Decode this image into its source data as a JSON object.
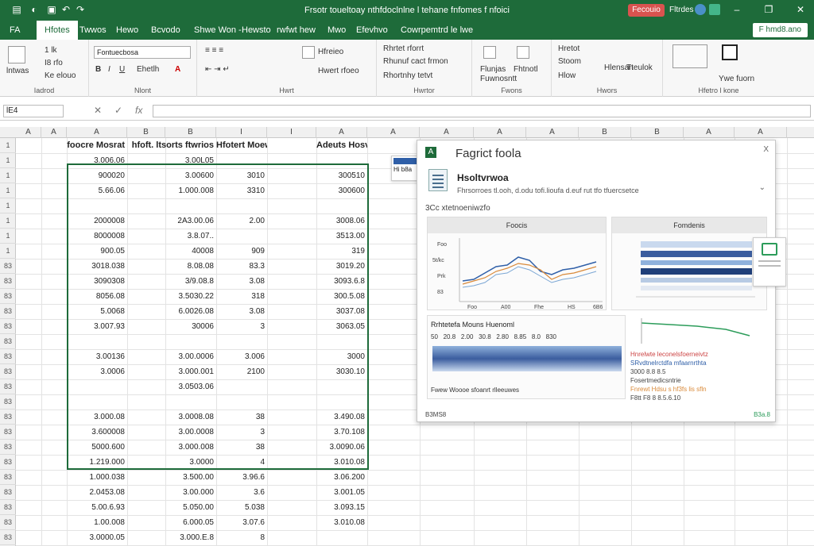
{
  "titlebar": {
    "doc_title": "Frsotr toueltoay nthfdoclnlne l tehane fnfomes f nfoici",
    "record_label": "Fecouio",
    "user_name": "Fltrdes"
  },
  "tabs": {
    "file": "FA",
    "items": [
      "Hfotes",
      "Twwos",
      "Hewo",
      "Bcvodo",
      "Shwe Won -",
      "Hewsto",
      "rwfwt hew",
      "Mwo",
      "Efevhvo",
      "Cowrpemtrd le lwe"
    ],
    "share": "F hmd8.ano"
  },
  "ribbon": {
    "groups": [
      {
        "label": "Iadrod",
        "items": [
          "lntwas",
          "1 lk",
          "I8 rfo",
          "Ke elouo"
        ]
      },
      {
        "label": "Nlont",
        "items": [
          "Fontuecbosa",
          "Ehetlh",
          "Hds"
        ]
      },
      {
        "label": "Hwrt",
        "items": [
          "Hfreieo",
          "Hwert rfoeo"
        ]
      },
      {
        "label": "Hwrtor",
        "items": [
          "Rhrtet rforrt",
          "Rhunuf cact frmon",
          "Rhortnhy tetvt"
        ]
      },
      {
        "label": "Fwons",
        "items": [
          "Flunjas",
          "Fhtnotl",
          "Fuwnosntt"
        ]
      },
      {
        "label": "Hwors",
        "items": [
          "Hretot",
          "Stoom",
          "Hlow",
          "Hlensan",
          "Tteulok"
        ]
      },
      {
        "label": "Hfetro l kone",
        "items": [
          "Ywe fuorn"
        ]
      }
    ]
  },
  "formula_bar": {
    "name_box": "lE4",
    "value": ""
  },
  "sheet": {
    "columns": [
      "A",
      "A",
      "A",
      "B",
      "B",
      "I",
      "I",
      "A",
      "A",
      "A",
      "A",
      "A",
      "B",
      "B",
      "A",
      "A"
    ],
    "rows": [
      "1",
      "1",
      "1",
      "1",
      "1",
      "1",
      "1",
      "1",
      "83",
      "83",
      "83",
      "83",
      "83",
      "83",
      "83",
      "83",
      "83",
      "83",
      "83",
      "83",
      "83",
      "83",
      "83",
      "83",
      "83",
      "83",
      "83"
    ],
    "headers": [
      "foocre Mosrat",
      "hfoft. ltsorts ftwrios",
      "Hfotert Moewn",
      "Adeuts Hosvo"
    ],
    "data": [
      [
        "3.006.06",
        "3.00L05",
        "",
        ""
      ],
      [
        "900020",
        "3.00600",
        "3010",
        "300510"
      ],
      [
        "5.66.06",
        "1.000.008",
        "3310",
        "300600"
      ],
      [
        "",
        "",
        "",
        ""
      ],
      [
        "2000008",
        "2A3.00.06",
        "2.00",
        "3008.06"
      ],
      [
        "8000008",
        "3.8.07..",
        "",
        "3513.00"
      ],
      [
        "900.05",
        "40008",
        "909",
        "319"
      ],
      [
        "3018.038",
        "8.08.08",
        "83.3",
        "3019.20"
      ],
      [
        "3090308",
        "3/9.08.8",
        "3.08",
        "3093.6.8"
      ],
      [
        "8056.08",
        "3.5030.22",
        "318",
        "300.5.08"
      ],
      [
        "5.0068",
        "6.0026.08",
        "3.08",
        "3037.08"
      ],
      [
        "3.007.93",
        "30006",
        "3",
        "3063.05"
      ],
      [
        "",
        "",
        "",
        ""
      ],
      [
        "3.00136",
        "3.00.0006",
        "3.006",
        "3000"
      ],
      [
        "3.0006",
        "3.000.001",
        "2100",
        "3030.10"
      ],
      [
        "",
        "3.0503.06",
        "",
        ""
      ],
      [
        "",
        "",
        "",
        ""
      ],
      [
        "3.000.08",
        "3.0008.08",
        "38",
        "3.490.08"
      ],
      [
        "3.600008",
        "3.00.0008",
        "3",
        "3.70.108"
      ],
      [
        "5000.600",
        "3.000.008",
        "38",
        "3.0090.06"
      ],
      [
        "1.219.000",
        "3.0000",
        "4",
        "3.010.08"
      ],
      [
        "1.000.038",
        "3.500.00",
        "3.96.6",
        "3.06.200"
      ],
      [
        "2.0453.08",
        "3.00.000",
        "3.6",
        "3.001.05"
      ],
      [
        "5.00.6.93",
        "5.050.00",
        "5.038",
        "3.093.15"
      ],
      [
        "1.00.008",
        "6.000.05",
        "3.07.6",
        "3.010.08"
      ],
      [
        "3.0000.05",
        "3.000.E.8",
        "8",
        ""
      ]
    ]
  },
  "panel": {
    "title": "Fagrict foola",
    "close_label": "X",
    "item_name": "Hsoltvrwoa",
    "item_desc": "Fhrsorroes tl.ooh, d.odu tofi.lioufa d.euf rut tfo tfuercsetce",
    "section_label": "3Cc xtetnoeniwzfo",
    "card1": {
      "title": "Foocis",
      "y_labels": [
        "Foo",
        "5t/kc",
        "Prk",
        "83"
      ],
      "x_labels": [
        "Foo",
        "A00",
        "Fhe",
        "HS",
        "6B6"
      ]
    },
    "card2": {
      "title": "Fomdenis"
    },
    "table_title": "Rrhtetefa Mouns Huenoml",
    "table_row": [
      "50",
      "20.8",
      "2.00",
      "30.8",
      "2.80",
      "8.85",
      "8.0",
      "830"
    ],
    "table_foot": "Fwew Woooe sfoanrt rlleeuwes",
    "legend_lines": [
      "Hnrelwte leconelsfoerneivtz",
      "SRvdtnelrctdfa mfaarnrthta",
      "3000 8.8 8.5",
      "Fosertmedicsntrie",
      "Fnrewt Hdsu s hf3fs lis sfln",
      "F8tt F8  8 8.5.6.10"
    ],
    "footer_left": "B3MS8",
    "footer_right": "B3a.8"
  },
  "tags": {
    "float_1": "Hi b8a",
    "float_2": "A"
  },
  "colors": {
    "brand": "#1e6b3a",
    "line_series_1": "#2f5fa8",
    "line_series_2": "#d98a3a",
    "line_series_3": "#2c9c5a"
  }
}
